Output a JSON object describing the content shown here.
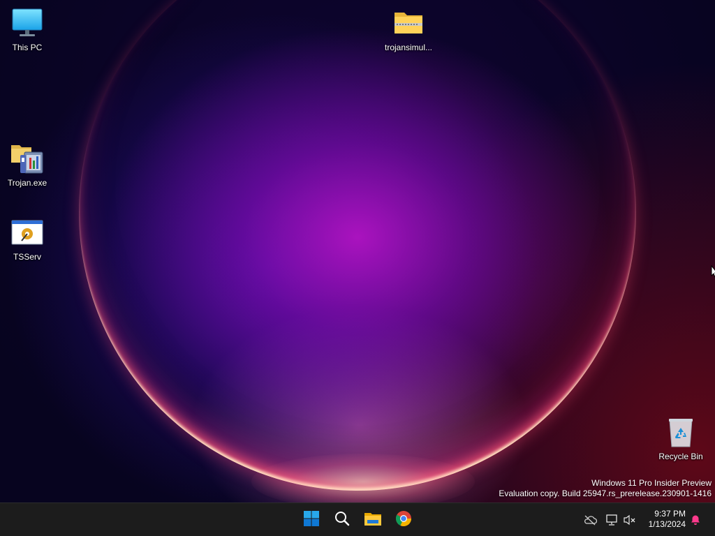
{
  "desktop": {
    "icons": [
      {
        "label": "This PC",
        "icon": "monitor-icon"
      },
      {
        "label": "trojansimul...",
        "icon": "zip-folder-icon"
      },
      {
        "label": "Trojan.exe",
        "icon": "installer-folder-icon"
      },
      {
        "label": "TSServ",
        "icon": "application-window-icon"
      },
      {
        "label": "Recycle Bin",
        "icon": "recycle-bin-icon"
      }
    ],
    "watermark": {
      "line1": "Windows 11 Pro Insider Preview",
      "line2": "Evaluation copy. Build 25947.rs_prerelease.230901-1416"
    }
  },
  "taskbar": {
    "pinned": [
      {
        "name": "Start",
        "icon": "windows-logo-icon"
      },
      {
        "name": "Search",
        "icon": "search-icon"
      },
      {
        "name": "File Explorer",
        "icon": "file-explorer-icon"
      },
      {
        "name": "Google Chrome",
        "icon": "chrome-icon"
      }
    ],
    "tray": {
      "icons": [
        "onedrive-offline-icon",
        "network-icon",
        "volume-muted-icon"
      ],
      "time": "9:37 PM",
      "date": "1/13/2024",
      "notification_icon": "bell-icon"
    }
  },
  "colors": {
    "taskbar_bg": "#1c1c1c",
    "accent_blue": "#0078d4",
    "notification": "#ff3a8c"
  }
}
